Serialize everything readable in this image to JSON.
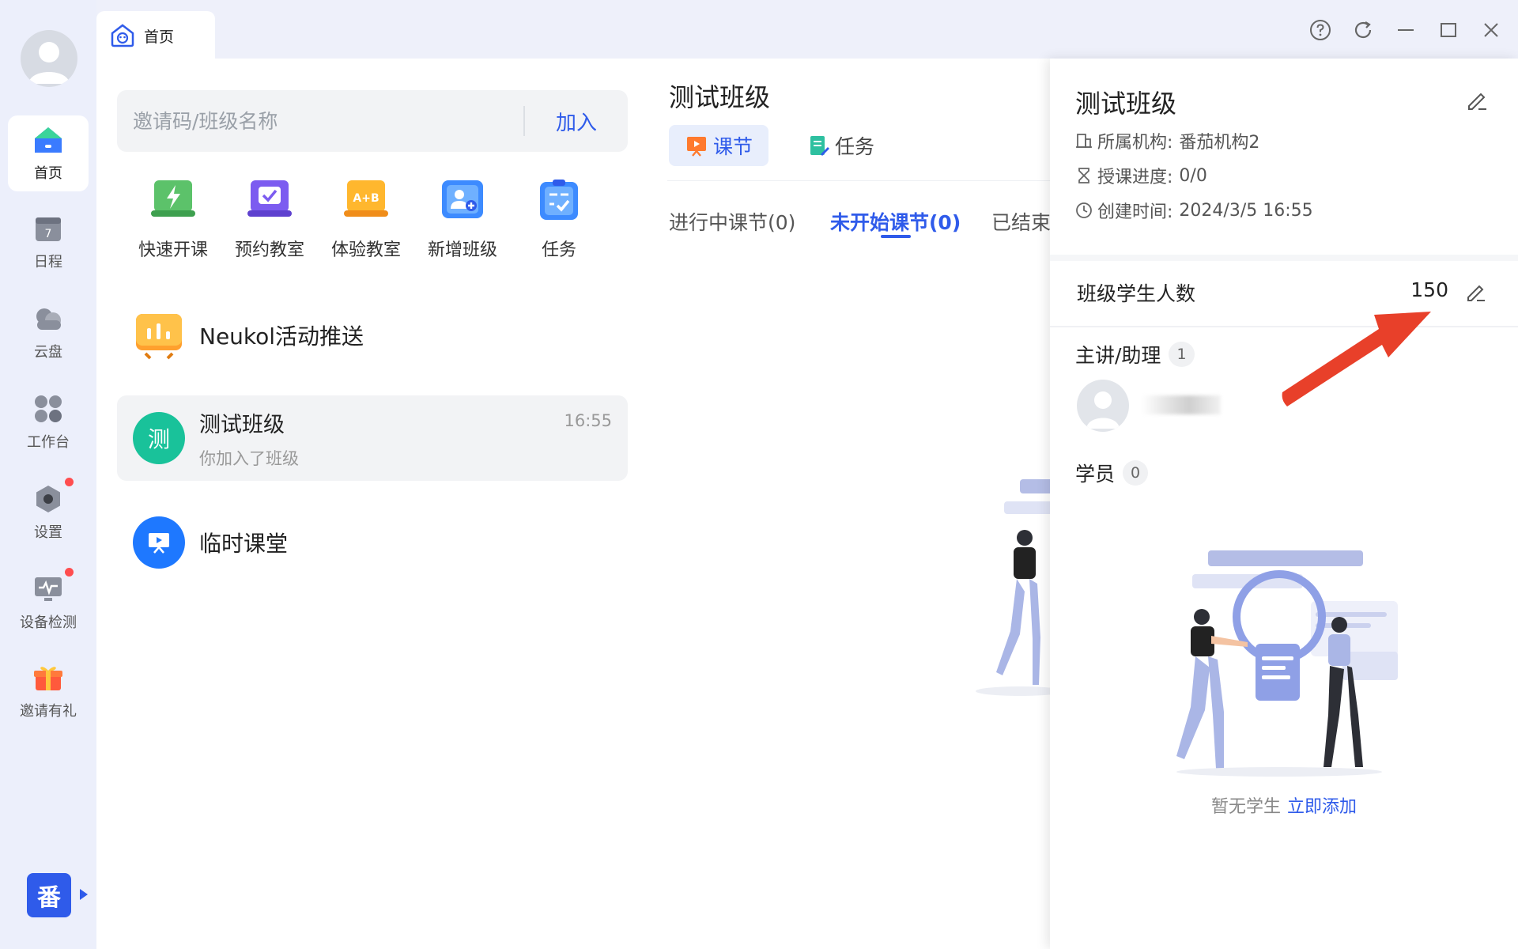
{
  "rail": {
    "items": [
      {
        "label": "首页",
        "icon": "home-icon",
        "active": true
      },
      {
        "label": "日程",
        "icon": "calendar-icon",
        "badge_text": "7"
      },
      {
        "label": "云盘",
        "icon": "cloud-drive-icon"
      },
      {
        "label": "工作台",
        "icon": "workbench-icon"
      },
      {
        "label": "设置",
        "icon": "settings-icon",
        "dot": true
      },
      {
        "label": "设备检测",
        "icon": "device-check-icon",
        "dot": true
      },
      {
        "label": "邀请有礼",
        "icon": "gift-icon"
      }
    ],
    "logo_text": "番"
  },
  "topbar": {
    "tab_label": "首页",
    "controls": [
      "help-icon",
      "refresh-icon",
      "minimize-icon",
      "maximize-icon",
      "close-icon"
    ]
  },
  "search": {
    "placeholder": "邀请码/班级名称",
    "value": "",
    "join_label": "加入"
  },
  "quick_actions": [
    {
      "label": "快速开课",
      "icon": "quick-start-icon"
    },
    {
      "label": "预约教室",
      "icon": "book-classroom-icon"
    },
    {
      "label": "体验教室",
      "icon": "trial-classroom-icon"
    },
    {
      "label": "新增班级",
      "icon": "add-class-icon"
    },
    {
      "label": "任务",
      "icon": "task-icon"
    }
  ],
  "list": {
    "promo": {
      "title": "Neukol活动推送"
    },
    "class_item": {
      "badge": "测",
      "title": "测试班级",
      "subtitle": "你加入了班级",
      "time": "16:55"
    },
    "temp_class": {
      "title": "临时课堂"
    }
  },
  "middle": {
    "title": "测试班级",
    "tabs": [
      {
        "label": "课节",
        "active": true
      },
      {
        "label": "任务",
        "active": false
      }
    ],
    "sub_tabs": [
      {
        "label": "进行中课节(0)",
        "active": false
      },
      {
        "label": "未开始课节(0)",
        "active": true
      },
      {
        "label": "已结束",
        "active": false
      }
    ]
  },
  "drawer": {
    "title": "测试班级",
    "org_label": "所属机构:",
    "org_value": "番茄机构2",
    "progress_label": "授课进度:",
    "progress_value": "0/0",
    "created_label": "创建时间:",
    "created_value": "2024/3/5 16:55",
    "student_count_label": "班级学生人数",
    "student_count_value": "150",
    "teachers_label": "主讲/助理",
    "teachers_count": "1",
    "students_label": "学员",
    "students_count": "0",
    "empty_text": "暂无学生",
    "add_link": "立即添加"
  },
  "colors": {
    "accent": "#2f5bea",
    "annotation_arrow": "#e8402a",
    "class_badge": "#19c29a",
    "temp_class": "#1e78ff"
  }
}
